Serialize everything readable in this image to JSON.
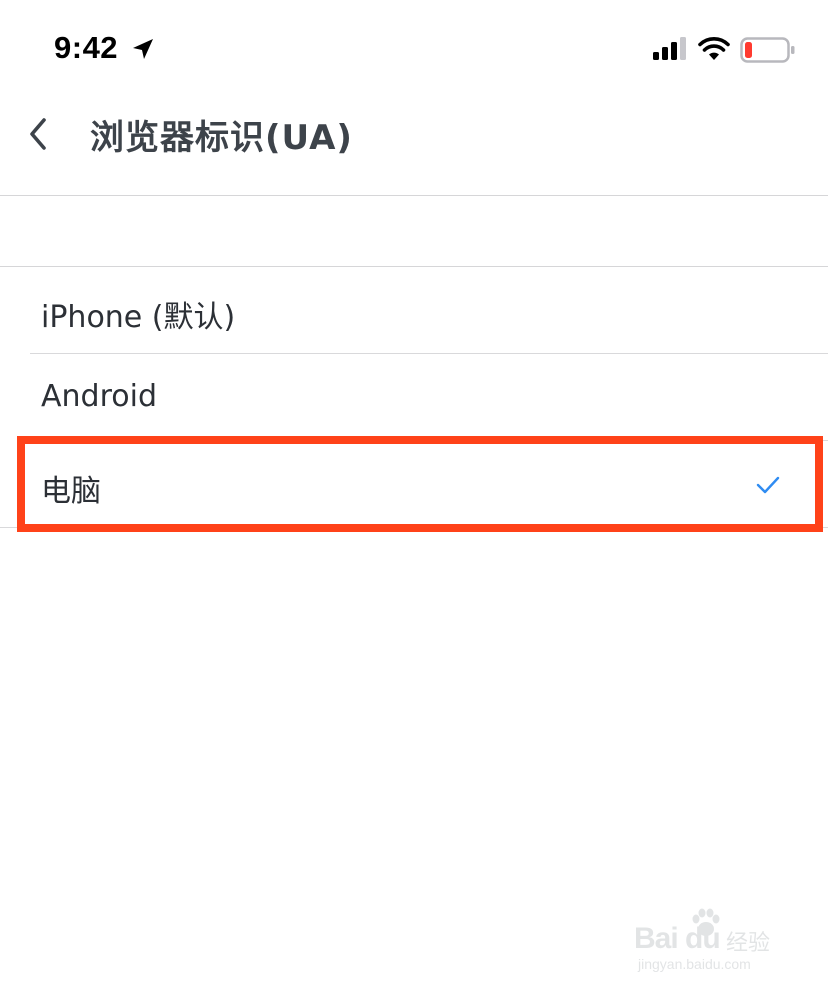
{
  "status_bar": {
    "time": "9:42",
    "icons": [
      "location-arrow-icon",
      "signal-icon",
      "wifi-icon",
      "battery-low-icon"
    ],
    "battery_color": "#ff3b30"
  },
  "nav": {
    "back_icon": "chevron-left-icon",
    "title": "浏览器标识(UA)"
  },
  "options": [
    {
      "label": "iPhone (默认)",
      "selected": false
    },
    {
      "label": "Android",
      "selected": false
    },
    {
      "label": "电脑",
      "selected": true
    }
  ],
  "colors": {
    "checkmark": "#2f8cf2",
    "highlight": "#ff4219",
    "divider": "#d6d6d8"
  },
  "watermark": {
    "brand": "Bai du",
    "sub": "经验",
    "url": "jingyan.baidu.com"
  }
}
